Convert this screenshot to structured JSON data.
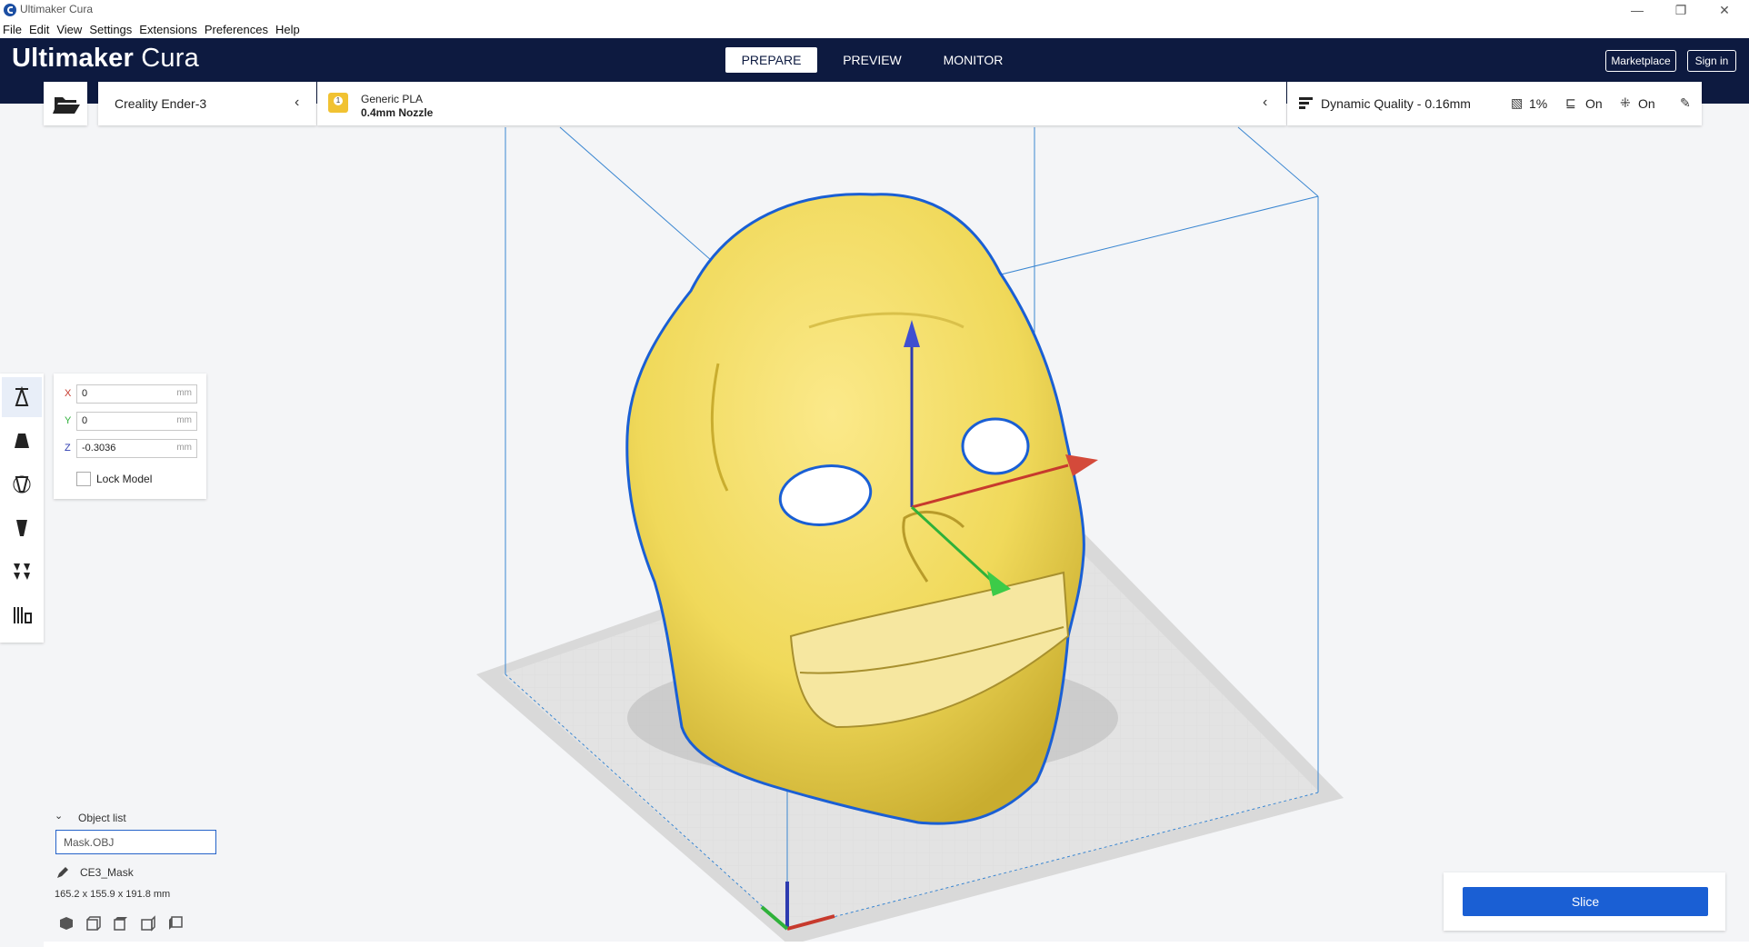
{
  "window": {
    "title": "Ultimaker Cura",
    "controls": [
      "—",
      "❐",
      "✕"
    ]
  },
  "menu": [
    "File",
    "Edit",
    "View",
    "Settings",
    "Extensions",
    "Preferences",
    "Help"
  ],
  "header": {
    "logo_bold": "Ultimaker",
    "logo_light": " Cura",
    "tabs": [
      "PREPARE",
      "PREVIEW",
      "MONITOR"
    ],
    "active_tab": "PREPARE",
    "marketplace": "Marketplace",
    "sign_in": "Sign in"
  },
  "printer": {
    "name": "Creality Ender-3"
  },
  "material": {
    "extruder": "1",
    "name": "Generic PLA",
    "nozzle": "0.4mm Nozzle"
  },
  "quality": {
    "profile": "Dynamic Quality - 0.16mm",
    "infill": "1%",
    "support": "On",
    "adhesion": "On"
  },
  "move_tool": {
    "x_label": "X",
    "x_value": "0",
    "y_label": "Y",
    "y_value": "0",
    "z_label": "Z",
    "z_value": "-0.3036",
    "unit": "mm",
    "lock_label": "Lock Model"
  },
  "object_list": {
    "header": "Object list",
    "selected": "Mask.OBJ",
    "name": "CE3_Mask",
    "dimensions": "165.2 x 155.9 x 191.8 mm"
  },
  "slice": {
    "label": "Slice"
  },
  "colors": {
    "header_bg": "#0d1a40",
    "model_fill": "#f0d95a",
    "outline": "#1a5fd4",
    "slice_button": "#1a5fd4",
    "material_badge": "#f1c232"
  }
}
